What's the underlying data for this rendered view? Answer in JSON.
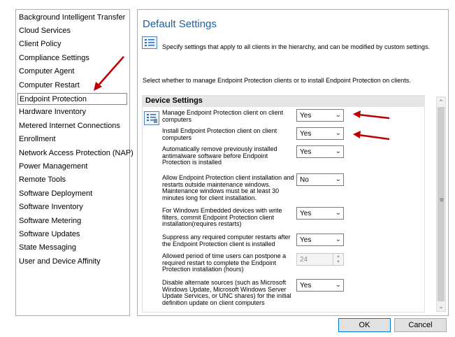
{
  "categories": [
    "Background Intelligent Transfer",
    "Cloud Services",
    "Client Policy",
    "Compliance Settings",
    "Computer Agent",
    "Computer Restart",
    "Endpoint Protection",
    "Hardware Inventory",
    "Metered Internet Connections",
    "Enrollment",
    "Network Access Protection (NAP)",
    "Power Management",
    "Remote Tools",
    "Software Deployment",
    "Software Inventory",
    "Software Metering",
    "Software Updates",
    "State Messaging",
    "User and Device Affinity"
  ],
  "selected_category": "Endpoint Protection",
  "main": {
    "title": "Default Settings",
    "description": "Specify settings that apply to all clients in the hierarchy, and can be modified by custom settings.",
    "instruction": "Select whether to manage Endpoint Protection clients or to install Endpoint Protection on clients.",
    "section_title": "Device Settings",
    "settings": [
      {
        "label": "Manage Endpoint Protection client on client computers",
        "value": "Yes",
        "enabled": true
      },
      {
        "label": "Install Endpoint Protection client on client computers",
        "value": "Yes",
        "enabled": true
      },
      {
        "label": "Automatically remove previously installed antimalware software before Endpoint Protection is installed",
        "value": "Yes",
        "enabled": true
      },
      {
        "label": "Allow Endpoint Protection client installation and restarts outside maintenance windows. Maintenance windows must be at least 30 minutes long for client installation.",
        "value": "No",
        "enabled": true
      },
      {
        "label": "For Windows Embedded devices with write filters, commit Endpoint Protection client installation(requires restarts)",
        "value": "Yes",
        "enabled": true
      },
      {
        "label": "Suppress any required computer restarts after the Endpoint Protection client is installed",
        "value": "Yes",
        "enabled": true
      },
      {
        "label": "Allowed period of time users can postpone a required restart to complete the Endpoint Protection installation (hours)",
        "value": "24",
        "enabled": false
      },
      {
        "label": "Disable alternate sources (such as Microsoft Windows Update, Microsoft Windows Server Update Services, or UNC shares) for the initial definition update on client computers",
        "value": "Yes",
        "enabled": true
      }
    ]
  },
  "buttons": {
    "ok": "OK",
    "cancel": "Cancel"
  },
  "colors": {
    "title": "#1e5faa",
    "selection_border": "#3399ff",
    "annotation_arrow": "#c00000"
  },
  "annotations": [
    "red-arrow",
    "red-arrow",
    "red-arrow"
  ]
}
